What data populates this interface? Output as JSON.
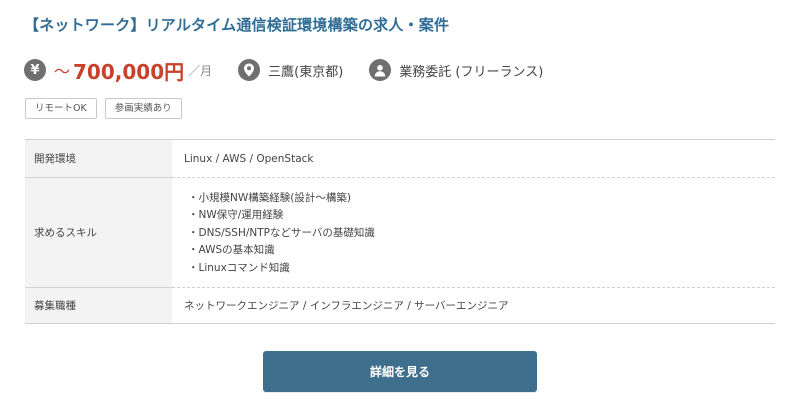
{
  "job": {
    "title": "【ネットワーク】リアルタイム通信検証環境構築の求人・案件",
    "salary": {
      "icon": "yen-icon",
      "prefix": "～",
      "amount": "700,000円",
      "unit": "／月"
    },
    "location": {
      "icon": "map-pin-icon",
      "text": "三鷹(東京都)"
    },
    "contract": {
      "icon": "person-icon",
      "text": "業務委託 (フリーランス)"
    },
    "tags": [
      "リモートOK",
      "参画実績あり"
    ],
    "details": {
      "environment": {
        "label": "開発環境",
        "value": "Linux / AWS / OpenStack"
      },
      "skills": {
        "label": "求めるスキル",
        "items": [
          "小規模NW構築経験(設計～構築)",
          "NW保守/運用経験",
          "DNS/SSH/NTPなどサーバの基礎知識",
          "AWSの基本知識",
          "Linuxコマンド知識"
        ]
      },
      "roles": {
        "label": "募集職種",
        "value": "ネットワークエンジニア / インフラエンジニア / サーバーエンジニア"
      }
    },
    "detail_button": "詳細を見る"
  },
  "colors": {
    "title": "#2f6d96",
    "salary": "#c8412b",
    "icon_bg": "#6f6f6f",
    "button_bg": "#3e6f8c",
    "header_cell_bg": "#f3f3f3"
  }
}
